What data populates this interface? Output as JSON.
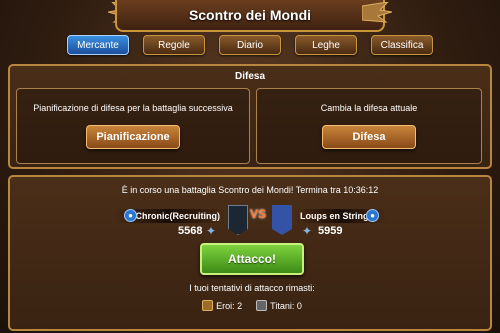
{
  "header": {
    "title": "Scontro dei Mondi"
  },
  "tabs": [
    {
      "label": "Mercante",
      "active": true
    },
    {
      "label": "Regole",
      "active": false
    },
    {
      "label": "Diario",
      "active": false
    },
    {
      "label": "Leghe",
      "active": false
    },
    {
      "label": "Classifica",
      "active": false
    }
  ],
  "defense": {
    "title": "Difesa",
    "planning_label": "Pianificazione di difesa per la battaglia successiva",
    "planning_button": "Pianificazione",
    "change_label": "Cambia la difesa attuale",
    "change_button": "Difesa"
  },
  "battle": {
    "info": "È in corso una battaglia Scontro dei Mondi! Termina tra 10:36:12",
    "left_guild": "Chronic(Recruiting)",
    "left_score": "5568",
    "vs_label": "VS",
    "right_guild": "Loups en String",
    "right_score": "5959",
    "attack_button": "Attacco!",
    "attempts_title": "I tuoi tentativi di attacco rimasti:",
    "heroes": "Eroi: 2",
    "titans": "Titani: 0"
  },
  "colors": {
    "active_tab": "#2a76d2",
    "attack_button": "#5aae28",
    "border_gold": "#c9963b"
  }
}
